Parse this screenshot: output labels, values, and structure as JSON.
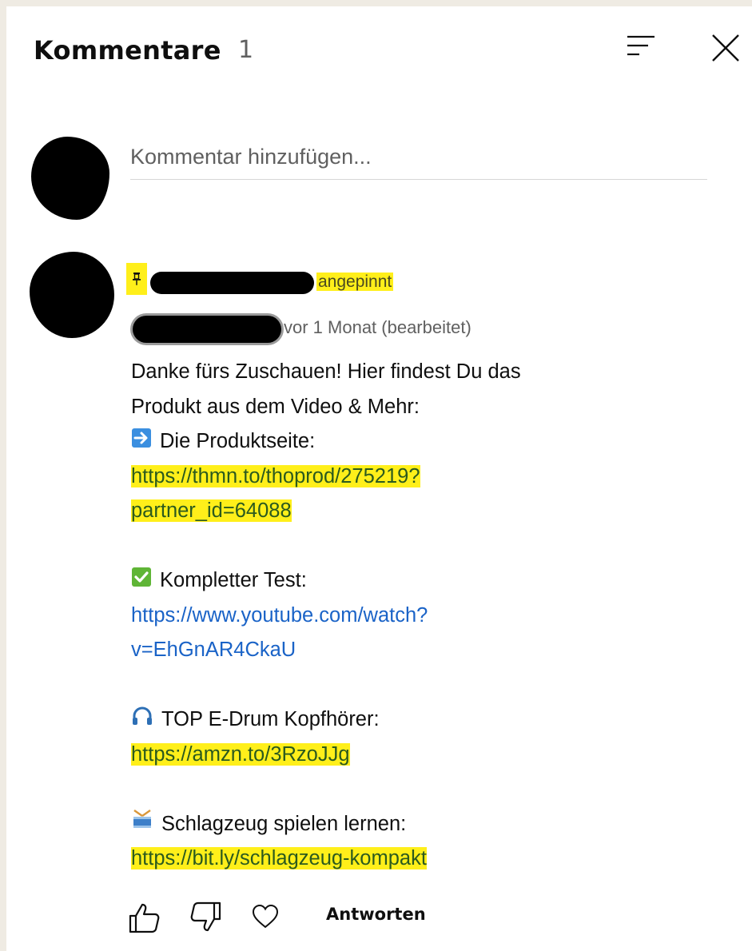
{
  "header": {
    "title": "Kommentare",
    "count": "1",
    "sort_icon": "sort-icon",
    "close_icon": "close-icon"
  },
  "add_comment": {
    "placeholder": "Kommentar hinzufügen..."
  },
  "comment": {
    "pinned_label": "angepinnt",
    "timestamp": "vor 1 Monat (bearbeitet)",
    "intro_line1": "Danke fürs Zuschauen! Hier findest Du das",
    "intro_line2": "Produkt aus dem Video & Mehr:",
    "sections": [
      {
        "icon": "right-arrow-emoji",
        "label": "Die Produktseite:",
        "link_line1": "https://thmn.to/thoprod/275219?",
        "link_line2": "partner_id=64088",
        "highlighted": true
      },
      {
        "icon": "check-mark-emoji",
        "label": "Kompletter Test:",
        "link_line1": "https://www.youtube.com/watch?",
        "link_line2": "v=EhGnAR4CkaU",
        "highlighted": false
      },
      {
        "icon": "headphone-emoji",
        "label": "TOP E-Drum Kopfhörer:",
        "link_line1": "https://amzn.to/3RzoJJg",
        "highlighted": true
      },
      {
        "icon": "drum-emoji",
        "label": "Schlagzeug spielen lernen:",
        "link_line1": "https://bit.ly/schlagzeug-kompakt",
        "highlighted": true
      }
    ],
    "actions": {
      "like_icon": "thumbs-up-icon",
      "dislike_icon": "thumbs-down-icon",
      "heart_icon": "heart-icon",
      "reply_label": "Antworten"
    }
  },
  "colors": {
    "highlight": "#ffef1a",
    "link": "#1a63c7",
    "secondary_text": "#606060",
    "background": "#efebe3"
  }
}
